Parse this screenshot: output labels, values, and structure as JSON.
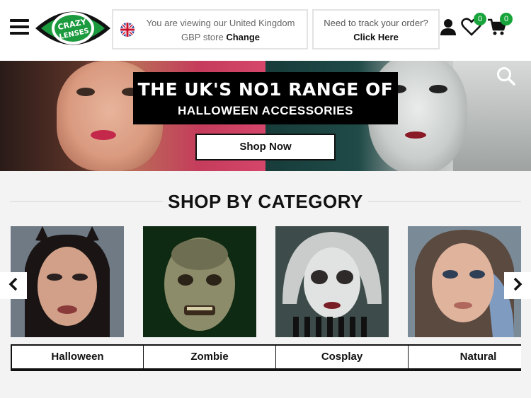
{
  "header": {
    "logo_text": "CRAZY LENSES",
    "store": {
      "line1": "You are viewing our United Kingdom",
      "line2_prefix": "GBP store",
      "change_label": "Change"
    },
    "track": {
      "line1": "Need to track your order?",
      "link_label": "Click Here"
    },
    "wishlist_count": "0",
    "cart_count": "0",
    "badge_color": "#18a33b"
  },
  "hero": {
    "title": "THE UK'S NO1 RANGE OF",
    "subtitle": "HALLOWEEN ACCESSORIES",
    "cta_label": "Shop Now"
  },
  "categories_section": {
    "title": "SHOP BY CATEGORY",
    "items": [
      {
        "label": "Halloween"
      },
      {
        "label": "Zombie"
      },
      {
        "label": "Cosplay"
      },
      {
        "label": "Natural"
      }
    ]
  },
  "icons": {
    "menu": "hamburger-icon",
    "account": "user-icon",
    "wishlist": "heart-icon",
    "cart": "cart-icon",
    "search": "search-icon",
    "prev": "chevron-left-icon",
    "next": "chevron-right-icon"
  }
}
